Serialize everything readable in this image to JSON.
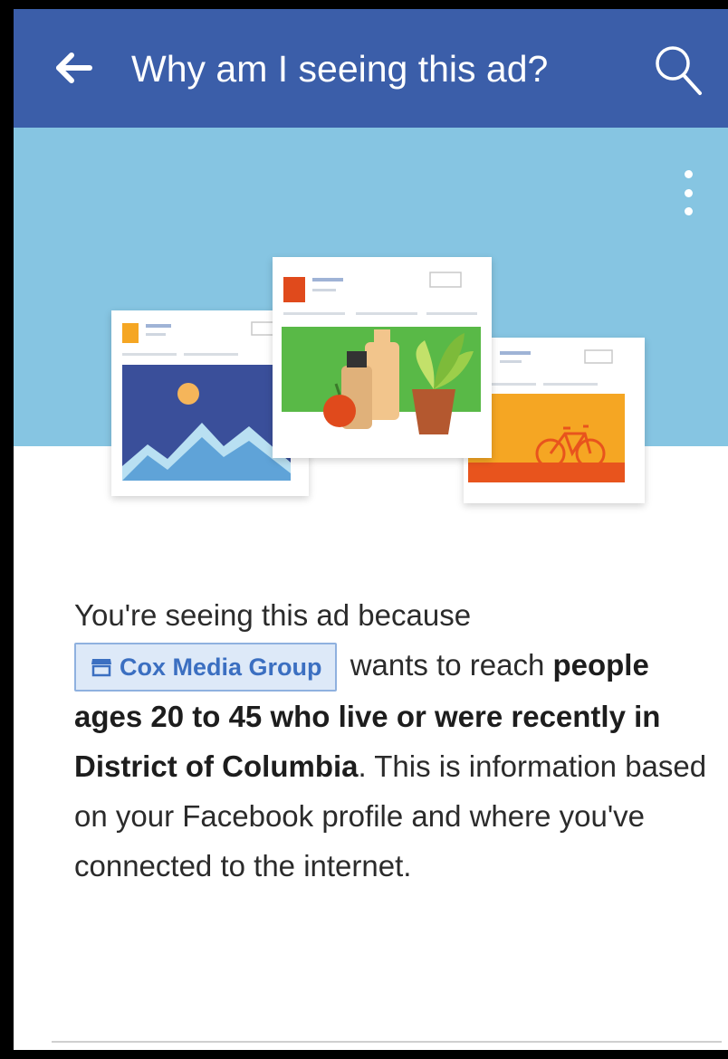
{
  "header": {
    "title": "Why am I seeing this ad?",
    "back_icon": "arrow-left-icon",
    "search_icon": "search-icon"
  },
  "banner": {
    "menu_icon": "more-vertical-icon",
    "illustration": "ad-cards-illustration"
  },
  "explanation": {
    "intro": "You're seeing this ad because",
    "advertiser": {
      "name": "Cox Media Group",
      "icon": "storefront-icon"
    },
    "wants_text": "wants to reach",
    "audience": "people ages 20 to 45 who live or were recently in District of Columbia",
    "rest": ". This is information based on your Facebook profile and where you've connected to the internet."
  },
  "colors": {
    "header": "#3b5ea9",
    "banner": "#86c5e2",
    "chip_bg": "#dde9f8",
    "chip_text": "#3b6fc1"
  }
}
